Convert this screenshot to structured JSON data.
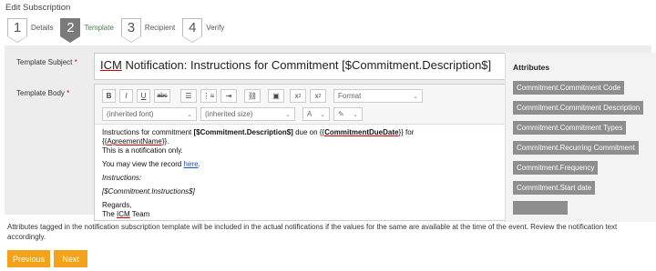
{
  "page": {
    "title": "Edit Subscription"
  },
  "wizard": {
    "steps": [
      {
        "number": "1",
        "label": "Details",
        "active": false
      },
      {
        "number": "2",
        "label": "Template",
        "active": true
      },
      {
        "number": "3",
        "label": "Recipient",
        "active": false
      },
      {
        "number": "4",
        "label": "Verify",
        "active": false
      }
    ]
  },
  "form": {
    "subject_label": "Template Subject",
    "body_label": "Template Body",
    "required_mark": "*",
    "subject_prefix": "ICM",
    "subject_rest": " Notification: Instructions for Commitment [$Commitment.Description$]"
  },
  "toolbar": {
    "bold": "B",
    "italic": "I",
    "underline": "U",
    "strike": "abc",
    "format_label": "Format",
    "font_label": "(inherited font)",
    "size_label": "(inherited size)",
    "font_color": "A",
    "subscript": "x",
    "superscript": "x"
  },
  "editor": {
    "line1_a": "Instructions for commitment ",
    "line1_b": "[$Commitment.Description$]",
    "line1_c": " due on {{",
    "line1_d": "CommitmentDueDate",
    "line1_e": "}} for",
    "line2_a": "{{",
    "line2_b": "AgreementName",
    "line2_c": "}}.",
    "line3": "This is a notification only.",
    "line4_a": "You may view the record ",
    "line4_link": "here",
    "line4_c": ".",
    "line5": "Instructions:",
    "line6": "[$Commitment.Instructions$]",
    "line7": "Regards,",
    "line8_a": "The ",
    "line8_b": "ICM",
    "line8_c": " Team"
  },
  "attributes": {
    "title": "Attributes",
    "items": [
      "Commitment.Commitment Code",
      "Commitment.Commitment Description",
      "Commitment.Commitment Types",
      "Commitment.Recurring Commitment",
      "Commitment.Frequency",
      "Commitment.Start date"
    ]
  },
  "hint": "Attributes tagged in the notification subscription template will be included in the actual notifications if the values for the same are available at the time of the event. Review the notification text accordingly.",
  "buttons": {
    "previous": "Previous",
    "next": "Next"
  },
  "colors": {
    "accent": "#f4a21c",
    "active_step": "#7a7a7a",
    "attribute_chip": "#8e8e8e",
    "link": "#1a4fd0"
  }
}
